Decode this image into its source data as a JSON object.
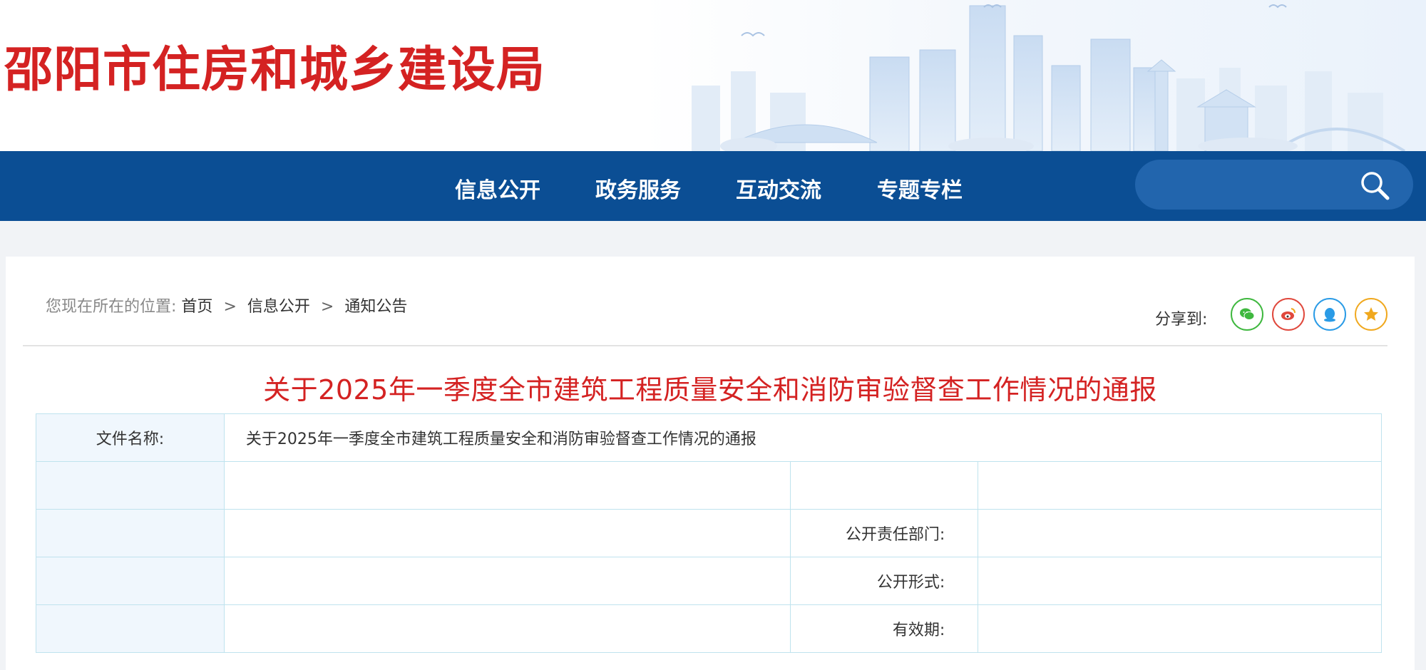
{
  "header": {
    "site_title": "邵阳市住房和城乡建设局"
  },
  "nav": {
    "items": [
      {
        "label": "信息公开"
      },
      {
        "label": "政务服务"
      },
      {
        "label": "互动交流"
      },
      {
        "label": "专题专栏"
      }
    ],
    "search_placeholder": ""
  },
  "breadcrumb": {
    "prefix": "您现在所在的位置:",
    "items": [
      "首页",
      "信息公开",
      "通知公告"
    ],
    "separator": ">"
  },
  "share": {
    "label": "分享到:",
    "buttons": [
      {
        "name": "wechat",
        "color": "#3fb83f"
      },
      {
        "name": "weibo",
        "color": "#e0483c"
      },
      {
        "name": "qq",
        "color": "#2a9be6"
      },
      {
        "name": "favorite",
        "color": "#f0a81e"
      }
    ]
  },
  "article": {
    "title": "关于2025年一季度全市建筑工程质量安全和消防审验督查工作情况的通报"
  },
  "info_table": {
    "file_name_label": "文件名称:",
    "file_name_value": "关于2025年一季度全市建筑工程质量安全和消防审验督查工作情况的通报",
    "dept_label": "公开责任部门:",
    "form_label": "公开形式:",
    "validity_label": "有效期:"
  },
  "colors": {
    "brand_red": "#d42222",
    "nav_blue": "#0b4e94",
    "table_border": "#bfe3ee"
  }
}
